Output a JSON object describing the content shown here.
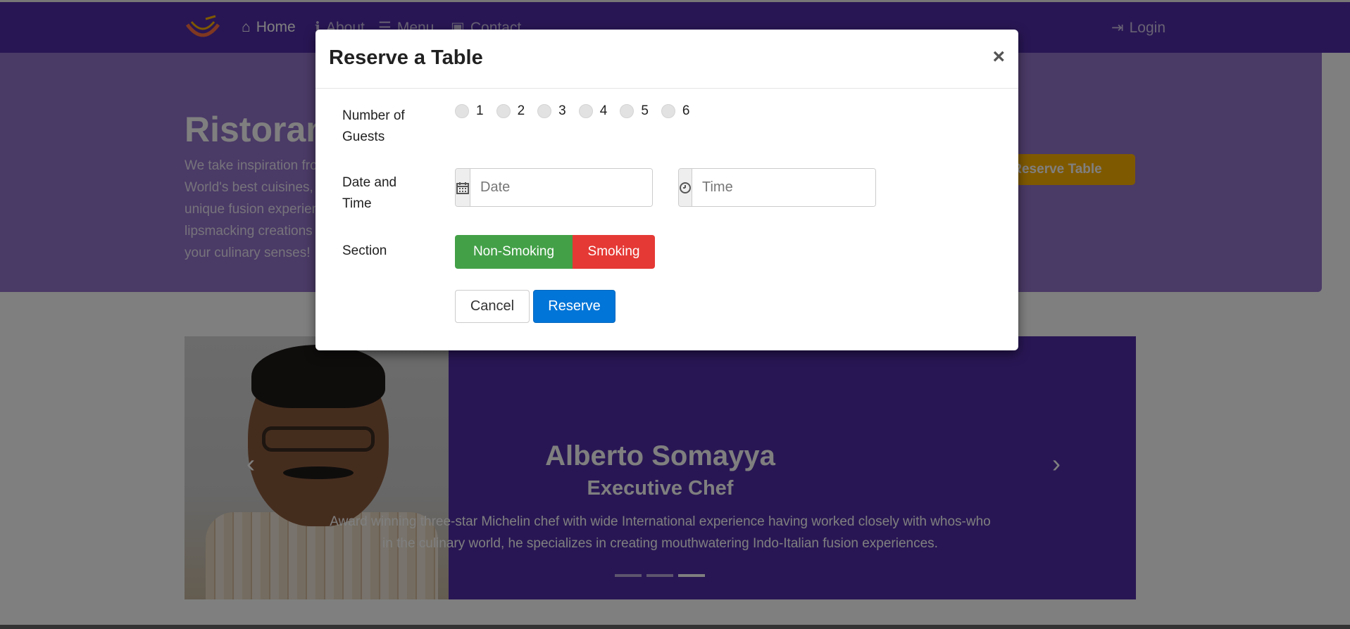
{
  "navbar": {
    "home": "Home",
    "about": "About",
    "menu": "Menu",
    "contact": "Contact",
    "login": "Login"
  },
  "jumbotron": {
    "title": "Ristorante con Fusion",
    "text": "We take inspiration from the World's best cuisines, and create a unique fusion experience. Our lipsmacking creations will tickle your culinary senses!",
    "button": "Reserve Table"
  },
  "carousel": {
    "name": "Alberto Somayya",
    "role": "Executive Chef",
    "description": "Award winning three-star Michelin chef with wide International experience having worked closely with whos-who in the culinary world, he specializes in creating mouthwatering Indo-Italian fusion experiences.",
    "active_index": 3,
    "slide_count": 3
  },
  "modal": {
    "title": "Reserve a Table",
    "close": "×",
    "guests_label": "Number of Guests",
    "guest_options": [
      "1",
      "2",
      "3",
      "4",
      "5",
      "6"
    ],
    "datetime_label": "Date and Time",
    "date_placeholder": "Date",
    "time_placeholder": "Time",
    "section_label": "Section",
    "nonsmoking": "Non-Smoking",
    "smoking": "Smoking",
    "cancel": "Cancel",
    "reserve": "Reserve"
  },
  "colors": {
    "navbar": "#512da8",
    "jumbotron": "#9575cd",
    "nonsmoking": "#43a047",
    "smoking": "#e53935",
    "reserve": "#0275d8"
  }
}
